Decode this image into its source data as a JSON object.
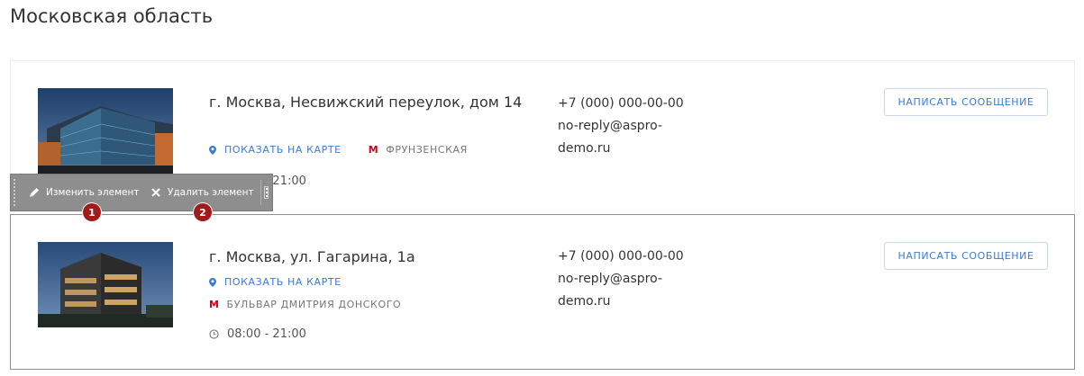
{
  "region": {
    "title": "Московская область"
  },
  "offices": [
    {
      "address": "г. Москва, Несвижский переулок, дом 14",
      "map_link": "ПОКАЗАТЬ НА КАРТЕ",
      "metro": "ФРУНЗЕНСКАЯ",
      "hours": "08:00 - 21:00",
      "phone": "+7 (000) 000-00-00",
      "email_line1": "no-reply@aspro-",
      "email_line2": "demo.ru",
      "button": "НАПИСАТЬ СООБЩЕНИЕ"
    },
    {
      "address": "г. Москва, ул. Гагарина, 1а",
      "map_link": "ПОКАЗАТЬ НА КАРТЕ",
      "metro": "БУЛЬВАР ДМИТРИЯ ДОНСКОГО",
      "hours": "08:00 - 21:00",
      "phone": "+7 (000) 000-00-00",
      "email_line1": "no-reply@aspro-",
      "email_line2": "demo.ru",
      "button": "НАПИСАТЬ СООБЩЕНИЕ"
    }
  ],
  "toolbar": {
    "edit_label": "Изменить элемент",
    "delete_label": "Удалить элемент",
    "badge1": "1",
    "badge2": "2"
  },
  "colors": {
    "accent": "#3a7bd5",
    "metro": "#d0021b",
    "badge": "#a31a1a",
    "toolbar": "#8e8e8e"
  },
  "icons": [
    "map-pin-icon",
    "metro-icon",
    "clock-icon",
    "pencil-icon",
    "close-icon",
    "menu-icon"
  ]
}
